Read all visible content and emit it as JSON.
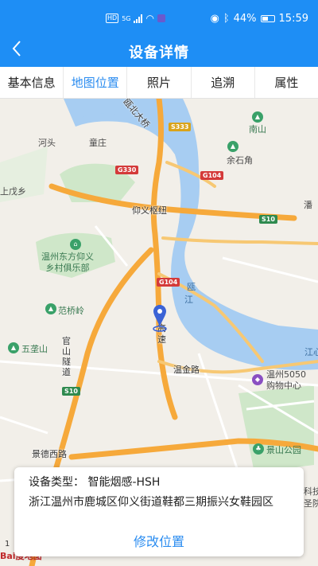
{
  "status": {
    "hd": "HD",
    "net": "5G",
    "battery": "44%",
    "time": "15:59"
  },
  "header": {
    "back_icon": "chevron-left-icon",
    "title": "设备详情"
  },
  "tabs": [
    {
      "label": "基本信息"
    },
    {
      "label": "地图位置"
    },
    {
      "label": "照片"
    },
    {
      "label": "追溯"
    },
    {
      "label": "属性"
    }
  ],
  "active_tab": 1,
  "map": {
    "labels": {
      "bridge": "瓯北大桥",
      "nanshan": "南山",
      "hetou": "河头",
      "tongqian": "童庄",
      "yushijiao": "余石角",
      "shangcheng": "上戊乡",
      "yiyi": "仰义枢纽",
      "club": "温州东方仰义\n乡村俱乐部",
      "ou": "瓯",
      "jiang": "江",
      "fanqiao": "范桥岭",
      "wuguishan": "五垄山",
      "guanshan": "官山隧道",
      "wenjin": "温金路",
      "mall": "温州5050\n购物中心",
      "jingde": "景德西路",
      "jingshan": "景山公园",
      "gaosu": "高速",
      "pan": "潘",
      "jiangxin": "江心",
      "keji": "科技",
      "shenguan": "圣院"
    },
    "shields": {
      "g333": "S333",
      "g330": "G330",
      "g104a": "G104",
      "g104b": "G104",
      "s10a": "S10",
      "s10b": "S10"
    },
    "scale": "1",
    "brand": "Bai度地图"
  },
  "info": {
    "type_label": "设备类型：",
    "type_value": "智能烟感-HSH",
    "address": "浙江温州市鹿城区仰义街道鞋都三期振兴女鞋园区",
    "edit_label": "修改位置"
  }
}
